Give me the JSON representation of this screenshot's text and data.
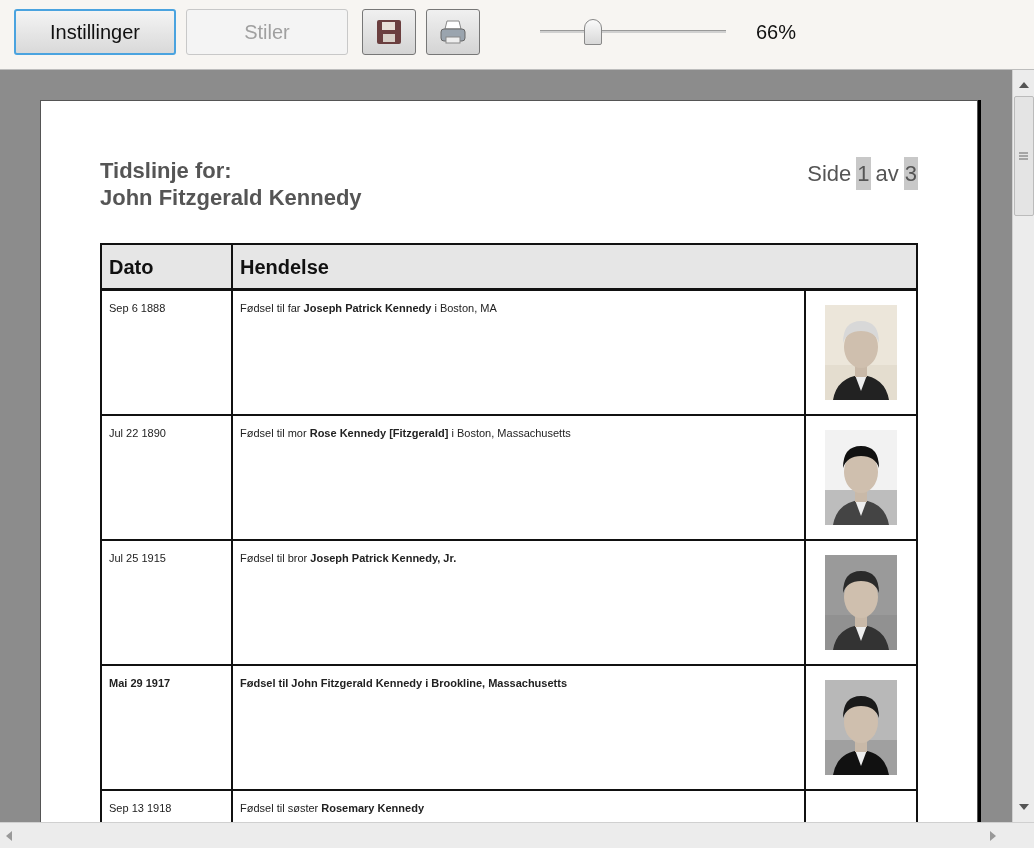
{
  "toolbar": {
    "buttons": [
      {
        "label": "Instillinger",
        "disabled": false
      },
      {
        "label": "Stiler",
        "disabled": true
      }
    ],
    "zoom": {
      "level": 0.26,
      "reading": "66%"
    }
  },
  "page": {
    "title": "Tidslinje for:",
    "subject": "John Fitzgerald Kennedy",
    "page_label": "Side",
    "page_number": "1",
    "page_of": "av",
    "page_count": "3",
    "table": {
      "columns": [
        "Dato",
        "Hendelse"
      ],
      "rows": [
        {
          "date": "Sep 6 1888",
          "event": "Fødsel til far **Joseph Patrick Kennedy** i Boston, MA",
          "bold": false
        },
        {
          "date": "Jul 22 1890",
          "event": "Fødsel til mor **Rose Kennedy [Fitzgerald]** i Boston, Massachusetts",
          "bold": false
        },
        {
          "date": "Jul 25 1915",
          "event": "Fødsel til bror **Joseph Patrick Kennedy, Jr.**",
          "bold": false
        },
        {
          "date": "Mai 29 1917",
          "event": "Fødsel til John Fitzgerald Kennedy i Brookline, Massachusetts",
          "bold": true
        },
        {
          "date": "Sep 13 1918",
          "event": "Fødsel til søster **Rosemary Kennedy**",
          "bold": false
        }
      ]
    }
  }
}
